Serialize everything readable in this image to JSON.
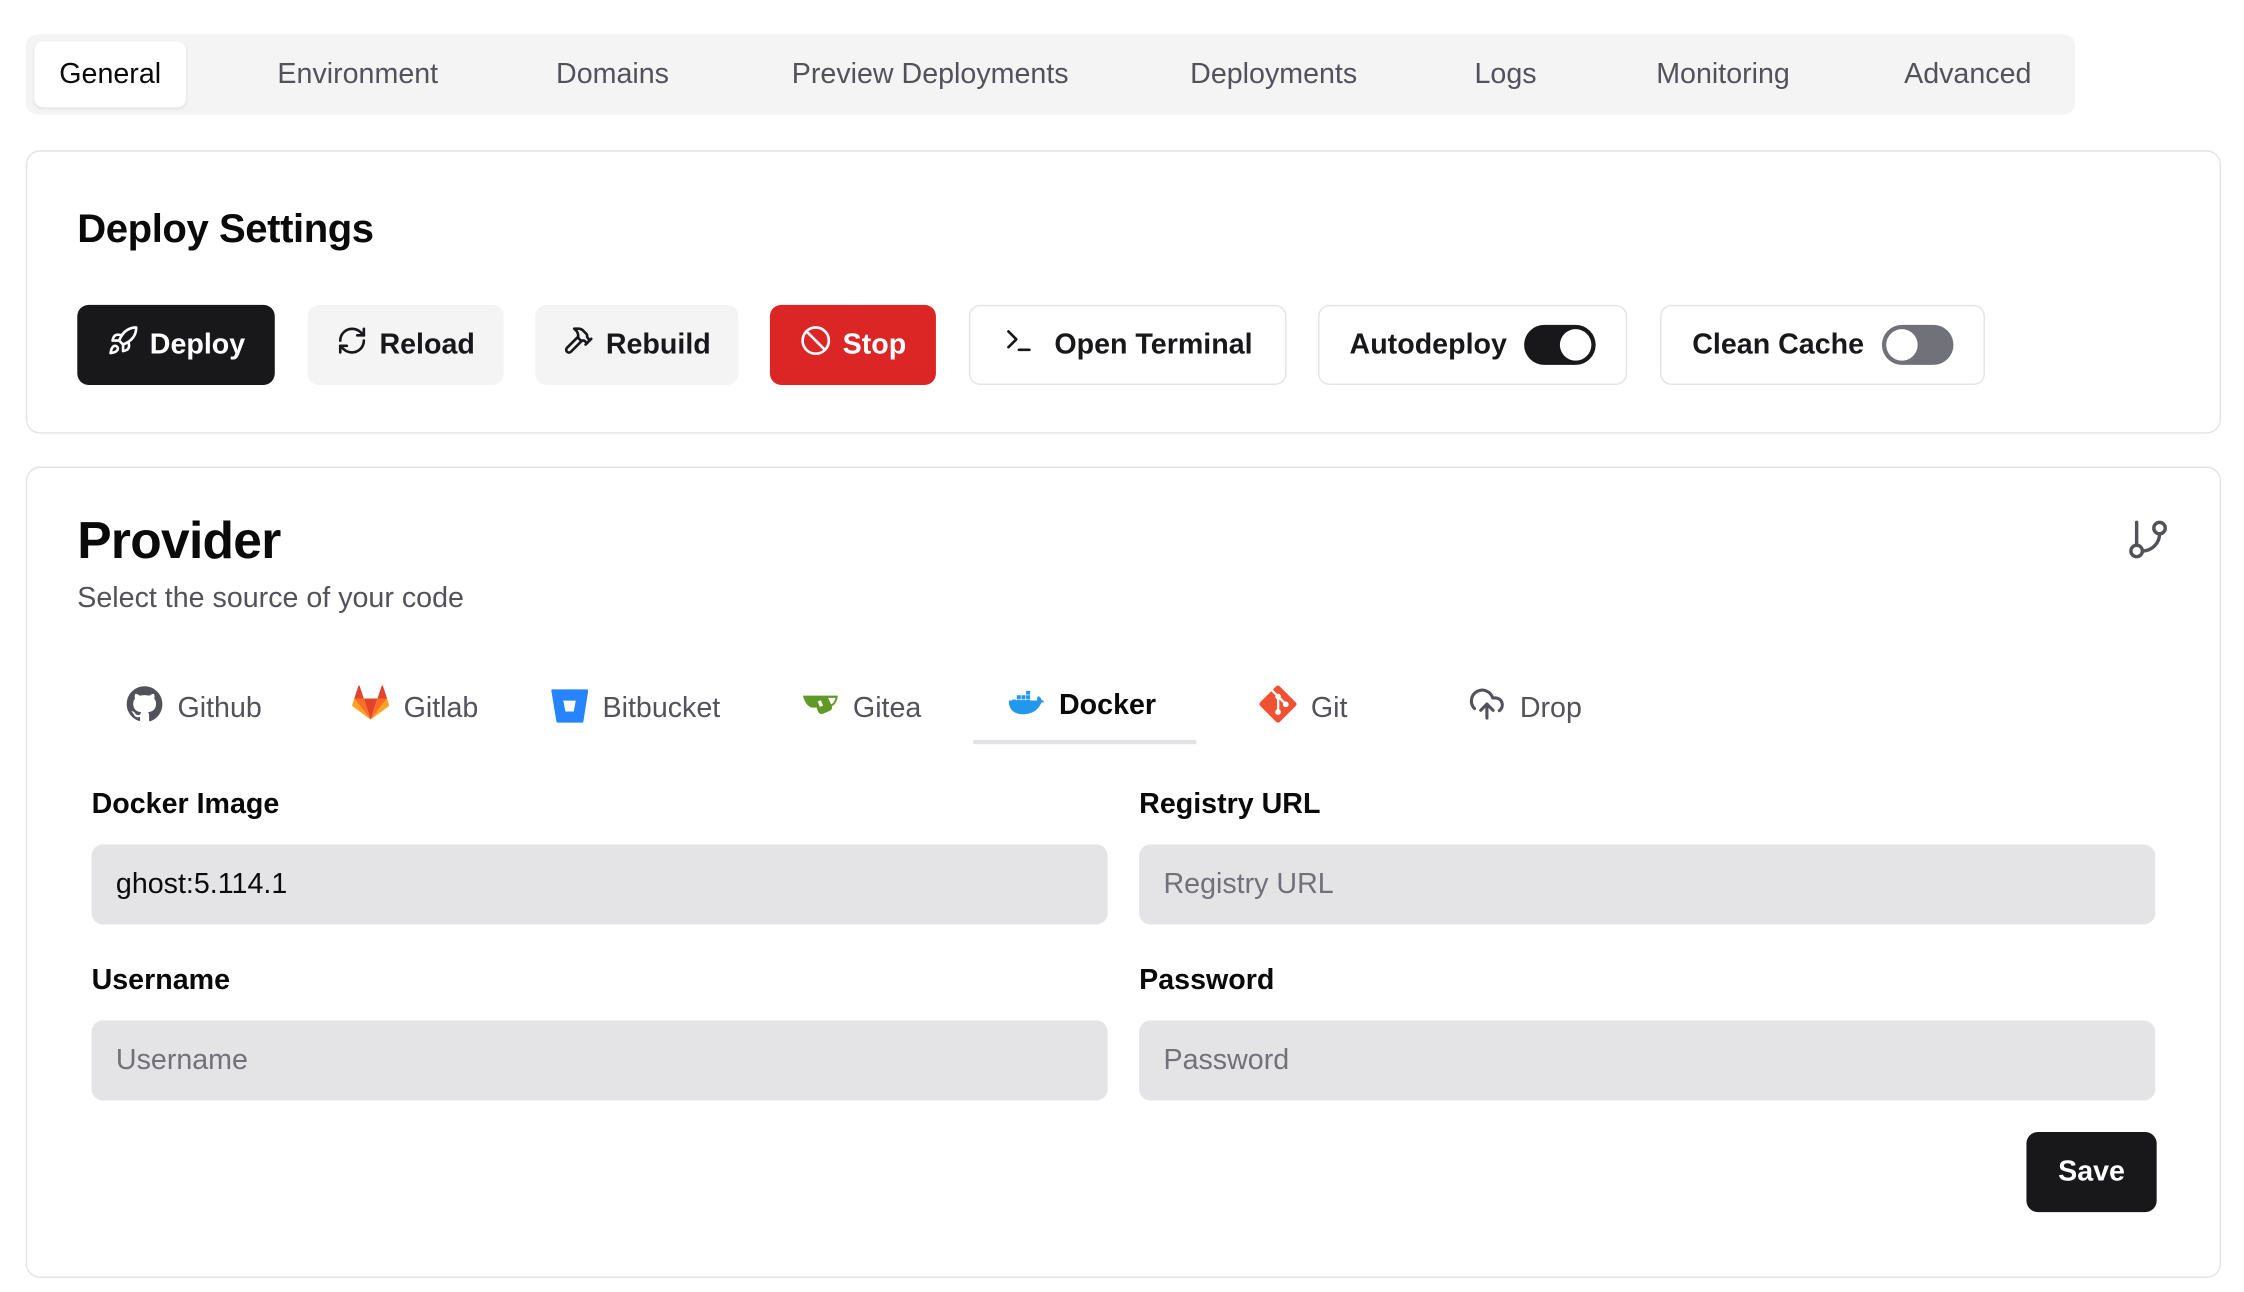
{
  "tabs": [
    {
      "label": "General",
      "active": true
    },
    {
      "label": "Environment"
    },
    {
      "label": "Domains"
    },
    {
      "label": "Preview Deployments"
    },
    {
      "label": "Deployments"
    },
    {
      "label": "Logs"
    },
    {
      "label": "Monitoring"
    },
    {
      "label": "Advanced"
    }
  ],
  "deploy_settings": {
    "title": "Deploy Settings",
    "deploy_label": "Deploy",
    "reload_label": "Reload",
    "rebuild_label": "Rebuild",
    "stop_label": "Stop",
    "terminal_label": "Open Terminal",
    "autodeploy_label": "Autodeploy",
    "autodeploy_on": true,
    "clean_cache_label": "Clean Cache",
    "clean_cache_on": false
  },
  "provider": {
    "title": "Provider",
    "subtitle": "Select the source of your code",
    "tabs": [
      {
        "label": "Github",
        "icon": "github-icon"
      },
      {
        "label": "Gitlab",
        "icon": "gitlab-icon"
      },
      {
        "label": "Bitbucket",
        "icon": "bitbucket-icon"
      },
      {
        "label": "Gitea",
        "icon": "gitea-icon"
      },
      {
        "label": "Docker",
        "icon": "docker-icon",
        "active": true
      },
      {
        "label": "Git",
        "icon": "git-icon"
      },
      {
        "label": "Drop",
        "icon": "cloud-upload-icon"
      }
    ],
    "form": {
      "docker_image_label": "Docker Image",
      "docker_image_value": "ghost:5.114.1",
      "registry_url_label": "Registry URL",
      "registry_url_placeholder": "Registry URL",
      "username_label": "Username",
      "username_placeholder": "Username",
      "password_label": "Password",
      "password_placeholder": "Password",
      "save_label": "Save"
    }
  },
  "colors": {
    "primary": "#18181b",
    "danger": "#dc2626",
    "muted": "#f4f4f5",
    "input_bg": "#e4e4e7"
  }
}
